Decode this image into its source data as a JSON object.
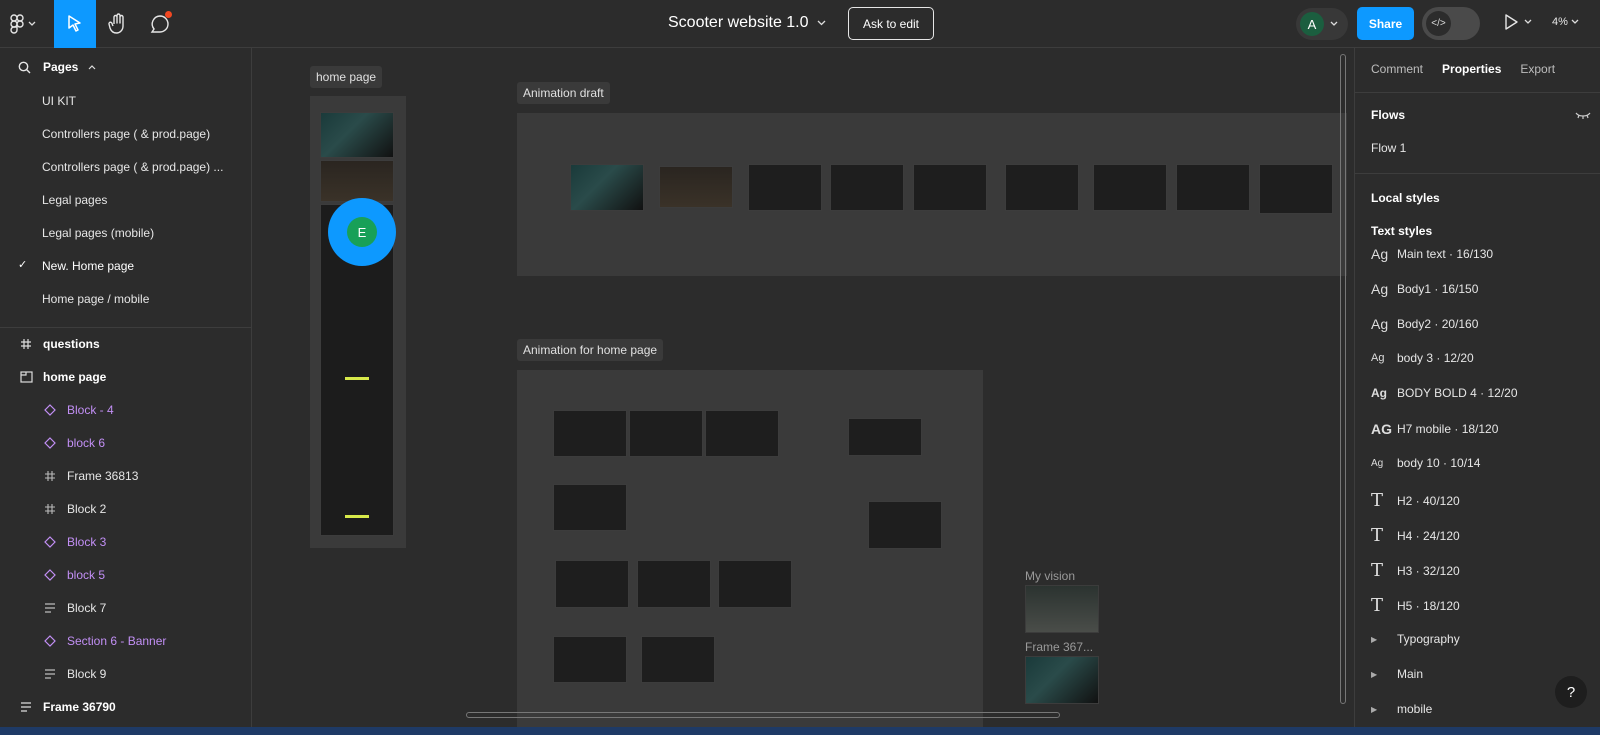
{
  "topbar": {
    "file_title": "Scooter website 1.0",
    "ask_to_edit": "Ask to edit",
    "avatar_initial": "A",
    "share": "Share",
    "zoom": "4%",
    "accent": "#0d99ff"
  },
  "left_panel": {
    "pages_label": "Pages",
    "pages": [
      "UI KIT",
      "Controllers page ( & prod.page)",
      "Controllers page ( & prod.page) ...",
      "Legal pages",
      "Legal pages (mobile)",
      "New. Home page",
      "Home page / mobile"
    ],
    "layers": [
      {
        "label": "questions",
        "icon": "frame-hash-icon"
      },
      {
        "label": "home page",
        "icon": "section-icon"
      },
      {
        "label": "Block - 4",
        "icon": "component-instance-icon"
      },
      {
        "label": "block 6",
        "icon": "component-instance-icon"
      },
      {
        "label": "Frame 36813",
        "icon": "frame-hash-icon"
      },
      {
        "label": "Block 2",
        "icon": "frame-hash-icon"
      },
      {
        "label": "Block 3",
        "icon": "component-instance-icon"
      },
      {
        "label": "block 5",
        "icon": "component-instance-icon"
      },
      {
        "label": "Block 7",
        "icon": "auto-layout-icon"
      },
      {
        "label": "Section 6 - Banner",
        "icon": "component-instance-icon"
      },
      {
        "label": "Block 9",
        "icon": "auto-layout-icon"
      },
      {
        "label": "Frame 36790",
        "icon": "auto-layout-icon"
      }
    ]
  },
  "canvas": {
    "home_page_label": "home page",
    "animation_draft_label": "Animation draft",
    "animation_home_label": "Animation for home page",
    "my_vision_label": "My vision",
    "frame_label": "Frame 367...",
    "cursor_initial": "E"
  },
  "right_panel": {
    "tabs": [
      "Comment",
      "Properties",
      "Export"
    ],
    "flows_title": "Flows",
    "flow_item": "Flow 1",
    "local_styles": "Local styles",
    "text_styles": "Text styles",
    "styles": [
      {
        "icon": "Ag",
        "label": "Main text · 16/130"
      },
      {
        "icon": "Ag",
        "label": "Body1 · 16/150"
      },
      {
        "icon": "Ag",
        "label": "Body2 · 20/160"
      },
      {
        "icon": "Ag",
        "label": "body 3 · 12/20"
      },
      {
        "icon": "Ag",
        "label": "BODY BOLD 4 · 12/20"
      },
      {
        "icon": "AG",
        "label": "H7 mobile · 18/120"
      },
      {
        "icon": "Ag",
        "label": "body 10 · 10/14"
      },
      {
        "icon": "T",
        "label": "H2 · 40/120"
      },
      {
        "icon": "T",
        "label": "H4 · 24/120"
      },
      {
        "icon": "T",
        "label": "H3 · 32/120"
      },
      {
        "icon": "T",
        "label": "H5 · 18/120"
      }
    ],
    "groups": [
      "Typography",
      "Main",
      "mobile"
    ],
    "help": "?"
  }
}
